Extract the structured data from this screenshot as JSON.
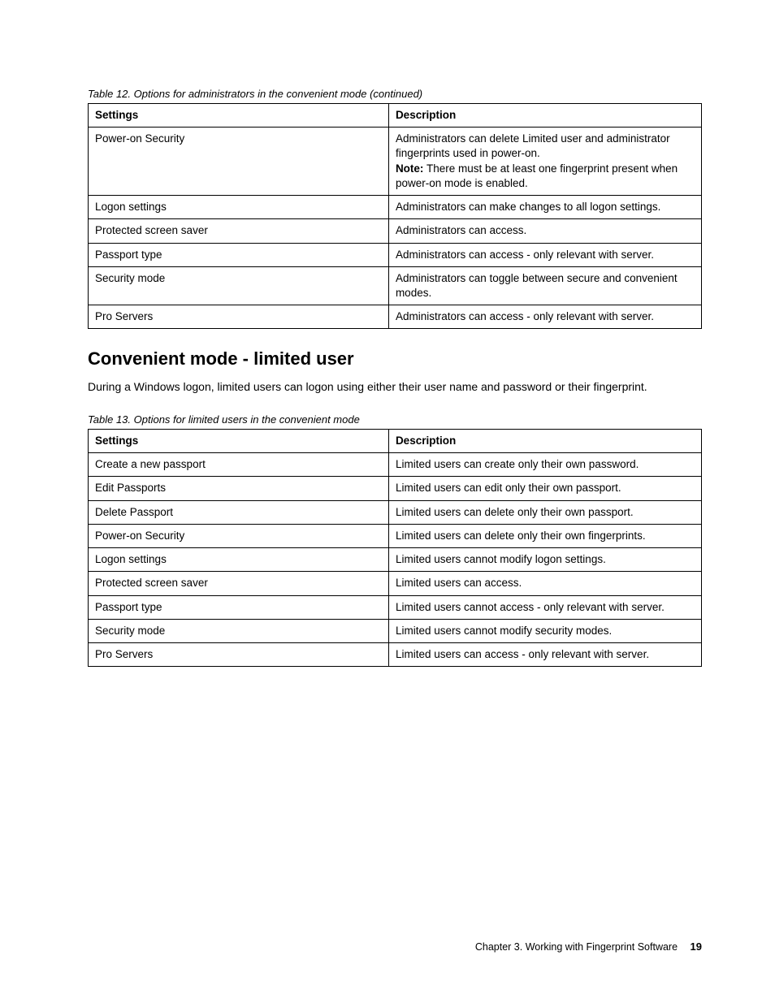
{
  "table12": {
    "caption": "Table 12.  Options for administrators in the convenient mode (continued)",
    "headers": {
      "settings": "Settings",
      "description": "Description"
    },
    "rows": [
      {
        "setting": "Power-on Security",
        "desc_pre": "Administrators can delete Limited user and administrator fingerprints used in power-on.",
        "note_label": "Note:",
        "desc_post": " There must be at least one fingerprint present when power-on mode is enabled."
      },
      {
        "setting": "Logon settings",
        "desc": "Administrators can make changes to all logon settings."
      },
      {
        "setting": "Protected screen saver",
        "desc": "Administrators can access."
      },
      {
        "setting": "Passport type",
        "desc": "Administrators can access - only relevant with server."
      },
      {
        "setting": "Security mode",
        "desc": "Administrators can toggle between secure and convenient modes."
      },
      {
        "setting": "Pro Servers",
        "desc": "Administrators can access - only relevant with server."
      }
    ]
  },
  "section": {
    "heading": "Convenient mode - limited user",
    "paragraph": "During a Windows logon, limited users can logon using either their user name and password or their fingerprint."
  },
  "table13": {
    "caption": "Table 13.  Options for limited users in the convenient mode",
    "headers": {
      "settings": "Settings",
      "description": "Description"
    },
    "rows": [
      {
        "setting": "Create a new passport",
        "desc": "Limited users can create only their own password."
      },
      {
        "setting": "Edit Passports",
        "desc": "Limited users can edit only their own passport."
      },
      {
        "setting": "Delete Passport",
        "desc": "Limited users can delete only their own passport."
      },
      {
        "setting": "Power-on Security",
        "desc": "Limited users can delete only their own fingerprints."
      },
      {
        "setting": "Logon settings",
        "desc": "Limited users cannot modify logon settings."
      },
      {
        "setting": "Protected screen saver",
        "desc": "Limited users can access."
      },
      {
        "setting": "Passport type",
        "desc": "Limited users cannot access - only relevant with server."
      },
      {
        "setting": "Security mode",
        "desc": "Limited users cannot modify security modes."
      },
      {
        "setting": "Pro Servers",
        "desc": "Limited users can access - only relevant with server."
      }
    ]
  },
  "footer": {
    "chapter": "Chapter 3.  Working with Fingerprint Software",
    "page": "19"
  }
}
